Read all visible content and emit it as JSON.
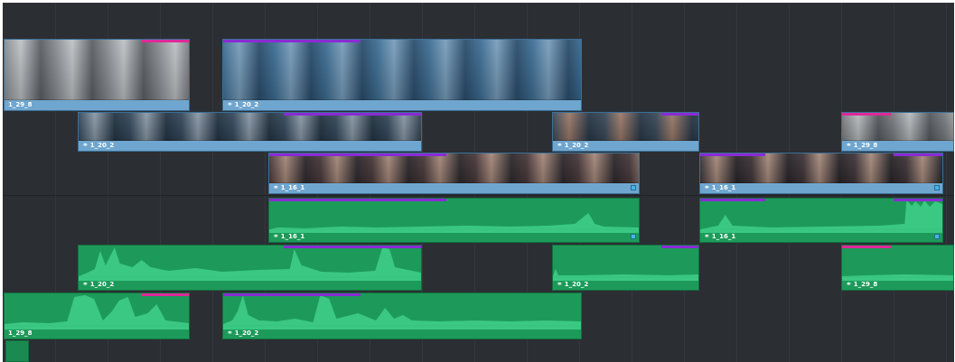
{
  "timeline": {
    "video_clips": [
      {
        "label": "1_29_8",
        "linked": false
      },
      {
        "label": "1_20_2",
        "linked": true
      },
      {
        "label": "1_20_2",
        "linked": true
      },
      {
        "label": "1_20_2",
        "linked": true
      },
      {
        "label": "1_29_8",
        "linked": true
      },
      {
        "label": "1_16_1",
        "linked": true
      },
      {
        "label": "1_16_1",
        "linked": true
      }
    ],
    "audio_clips": [
      {
        "label": "1_16_1",
        "linked": true
      },
      {
        "label": "1_16_1",
        "linked": true
      },
      {
        "label": "1_20_2",
        "linked": true
      },
      {
        "label": "1_20_2",
        "linked": true
      },
      {
        "label": "1_29_8",
        "linked": true
      },
      {
        "label": "1_29_8",
        "linked": false
      },
      {
        "label": "1_20_2",
        "linked": true
      }
    ],
    "colors": {
      "background": "#2b2e33",
      "video_clip": "#6fa6cf",
      "audio_clip": "#1d9a5a",
      "waveform": "#3fd08a",
      "marker_magenta": "#e0289a",
      "marker_purple": "#8a2bd4",
      "end_marker": "#4bb3e6"
    },
    "icons": {
      "link": "link-icon",
      "end": "clip-end-marker"
    }
  }
}
